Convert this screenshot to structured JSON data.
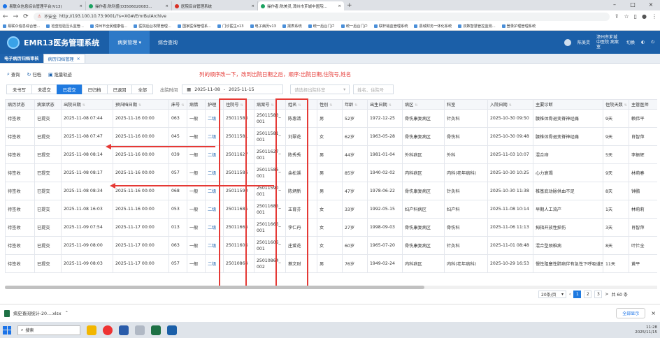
{
  "browser": {
    "tabs": [
      {
        "title": "易联众信息综合管理平台(V13)",
        "active": false
      },
      {
        "title": "操作者:陈钊盛(D3506020083...",
        "active": false
      },
      {
        "title": "医院后台管理系统",
        "active": false
      },
      {
        "title": "操作者:陈美灵,漳州市芗城中医院...",
        "active": true
      }
    ],
    "new_tab": "+",
    "security": "不安全",
    "url": "http://193.100.10.73:9001/?s=XG#/EmrBulArchive",
    "bookmarks": [
      "易联众信息综合管...",
      "检查检验互认监管...",
      "漳州市全民健康信...",
      "医院后台权限管理...",
      "国家医保管理系...",
      "门诊医生v13",
      "电子病历v13",
      "报表系统",
      "统一后台门户",
      "统一后台门户",
      "联轩输血管理系统",
      "县城财务一体化系统",
      "双数智慧管控监测...",
      "登录护理管理系统"
    ]
  },
  "app": {
    "title": "EMR13医务管理系统",
    "menu": [
      "病案管理",
      "综合查询"
    ],
    "user": "陈美灵",
    "org": "漳州市芗城中医院 病案室",
    "switch": "切换"
  },
  "subtabs": {
    "t1": "电子病历归档审核",
    "t2": "病历归档管理"
  },
  "toolbar": {
    "query": "查询",
    "archive": "归档",
    "batch": "批量轨迹"
  },
  "note": "列的顺序改一下，改到出院日期之后，顺序:出院日期,住院号,姓名",
  "filters": {
    "status_tabs": [
      "未书写",
      "未提交",
      "已提交",
      "已归档",
      "已退回",
      "全部"
    ],
    "active_status": "已提交",
    "date_label": "出院时间",
    "date_start": "2025-11-08",
    "date_sep": "-",
    "date_end": "2025-11-15",
    "dept_placeholder": "请选择出院科室",
    "name_placeholder": "姓名、住院号"
  },
  "table": {
    "headers": [
      "病历状态",
      "病案状态",
      "出院日期",
      "预归档日期",
      "床号",
      "病情",
      "护理",
      "住院号",
      "病案号",
      "姓名",
      "性别",
      "年龄",
      "出生日期",
      "病区",
      "科室",
      "入院日期",
      "主要诊断",
      "住院天数",
      "主管医师"
    ],
    "rows": [
      [
        "待签收",
        "已提交",
        "2025-11-08 07:44",
        "2025-11-16 00:00",
        "063",
        "一般",
        "二级",
        "25011583",
        "25011583_001",
        "陈惠清",
        "男",
        "52岁",
        "1972-12-25",
        "骨伤康复病区",
        "针灸科",
        "2025-10-30 09:50",
        "腰椎体骨退变脊神经痛",
        "9天",
        "赖伟平"
      ],
      [
        "待签收",
        "已提交",
        "2025-11-08 07:47",
        "2025-11-16 00:00",
        "045",
        "一般",
        "二级",
        "25011581",
        "25011581_001",
        "刘翠花",
        "女",
        "62岁",
        "1963-05-28",
        "骨伤康复病区",
        "骨伤科",
        "2025-10-30 09:48",
        "腰椎体骨退变脊神经痛",
        "9天",
        "肖智萍"
      ],
      [
        "待签收",
        "已提交",
        "2025-11-08 08:14",
        "2025-11-16 00:00",
        "039",
        "一般",
        "二级",
        "25011627",
        "25011627_001",
        "陈秀秀",
        "男",
        "44岁",
        "1981-01-04",
        "外科病区",
        "外科",
        "2025-11-03 10:07",
        "混合痔",
        "5天",
        "李振辉"
      ],
      [
        "待签收",
        "已提交",
        "2025-11-08 08:17",
        "2025-11-16 00:00",
        "057",
        "一般",
        "二级",
        "25011586",
        "25011586_001",
        "余松溪",
        "男",
        "85岁",
        "1940-02-02",
        "内科病区",
        "内科(老年病科)",
        "2025-10-30 10:25",
        "心力衰竭",
        "9天",
        "林莉春"
      ],
      [
        "待签收",
        "已提交",
        "2025-11-08 08:34",
        "2025-11-16 00:00",
        "068",
        "一般",
        "二级",
        "25011590",
        "25011590_001",
        "陈炳新",
        "男",
        "47岁",
        "1978-06-22",
        "骨伤康复病区",
        "针灸科",
        "2025-10-30 11:38",
        "椎基底动脉供血不足",
        "8天",
        "钟鹏"
      ],
      [
        "待签收",
        "已提交",
        "2025-11-08 16:03",
        "2025-11-16 00:00",
        "053",
        "一般",
        "二级",
        "25011685",
        "25011685_001",
        "王育芬",
        "女",
        "33岁",
        "1992-05-15",
        "妇产科病区",
        "妇产科",
        "2025-11-08 10:14",
        "早期人工流产",
        "1天",
        "林莉莉"
      ],
      [
        "待签收",
        "已提交",
        "2025-11-09 07:54",
        "2025-11-17 00:00",
        "013",
        "一般",
        "二级",
        "25011666",
        "25011666_001",
        "李仁丹",
        "女",
        "27岁",
        "1998-09-03",
        "骨伤康复病区",
        "骨伤科",
        "2025-11-06 11:13",
        "拇指开放性损伤",
        "3天",
        "肖智萍"
      ],
      [
        "待签收",
        "已提交",
        "2025-11-09 08:00",
        "2025-11-17 00:00",
        "063",
        "一般",
        "二级",
        "25011606",
        "25011606_001",
        "庄爱花",
        "女",
        "60岁",
        "1965-07-20",
        "骨伤康复病区",
        "针灸科",
        "2025-11-01 08:48",
        "混合型颈椎病",
        "8天",
        "叶忙全"
      ],
      [
        "待签收",
        "已提交",
        "2025-11-09 08:03",
        "2025-11-17 00:00",
        "057",
        "一般",
        "二级",
        "25010864",
        "25010864_002",
        "蔡文财",
        "男",
        "76岁",
        "1949-02-24",
        "内科病区",
        "内科(老年病科)",
        "2025-10-29 16:53",
        "慢性阻塞性肺病伴有急性下呼吸道感染",
        "11天",
        "黄平"
      ]
    ]
  },
  "pager": {
    "size": "20条/页",
    "pages": [
      "1",
      "2",
      "3"
    ],
    "current": "1",
    "next": ">",
    "total": "共 60 条"
  },
  "download": {
    "file": "病史查阅统计-20....xlsx",
    "show_all": "全部显示",
    "close": "×"
  },
  "taskbar": {
    "search": "搜索",
    "time": "11:28",
    "date": "2025/11/15"
  },
  "colors": {
    "header_blue": "#1b5fa8",
    "active_blue": "#1f7ae0",
    "annotation_red": "#e53935"
  }
}
